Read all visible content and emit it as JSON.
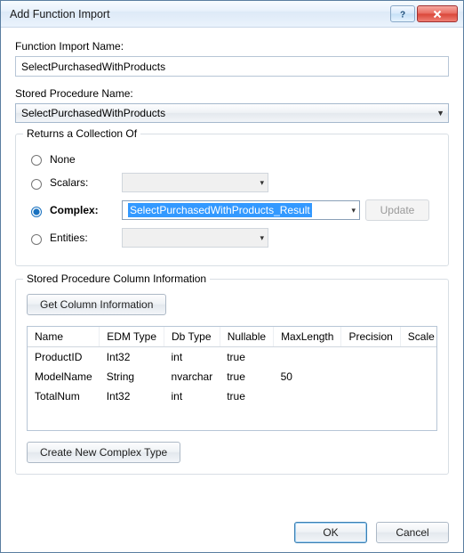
{
  "window": {
    "title": "Add Function Import"
  },
  "functionImportName": {
    "label": "Function Import Name:",
    "value": "SelectPurchasedWithProducts"
  },
  "storedProcedureName": {
    "label": "Stored Procedure Name:",
    "value": "SelectPurchasedWithProducts"
  },
  "returnsGroup": {
    "title": "Returns a Collection Of",
    "options": {
      "none": {
        "label": "None",
        "checked": false
      },
      "scalars": {
        "label": "Scalars:",
        "checked": false,
        "value": ""
      },
      "complex": {
        "label": "Complex:",
        "checked": true,
        "value": "SelectPurchasedWithProducts_Result"
      },
      "entities": {
        "label": "Entities:",
        "checked": false,
        "value": ""
      }
    },
    "updateButton": "Update"
  },
  "columnInfoGroup": {
    "title": "Stored Procedure Column Information",
    "getColumnsButton": "Get Column Information",
    "createComplexButton": "Create New Complex Type",
    "headers": [
      "Name",
      "EDM Type",
      "Db Type",
      "Nullable",
      "MaxLength",
      "Precision",
      "Scale"
    ],
    "rows": [
      {
        "name": "ProductID",
        "edm": "Int32",
        "db": "int",
        "nullable": "true",
        "maxlen": "",
        "precision": "",
        "scale": ""
      },
      {
        "name": "ModelName",
        "edm": "String",
        "db": "nvarchar",
        "nullable": "true",
        "maxlen": "50",
        "precision": "",
        "scale": ""
      },
      {
        "name": "TotalNum",
        "edm": "Int32",
        "db": "int",
        "nullable": "true",
        "maxlen": "",
        "precision": "",
        "scale": ""
      }
    ]
  },
  "buttons": {
    "ok": "OK",
    "cancel": "Cancel"
  }
}
